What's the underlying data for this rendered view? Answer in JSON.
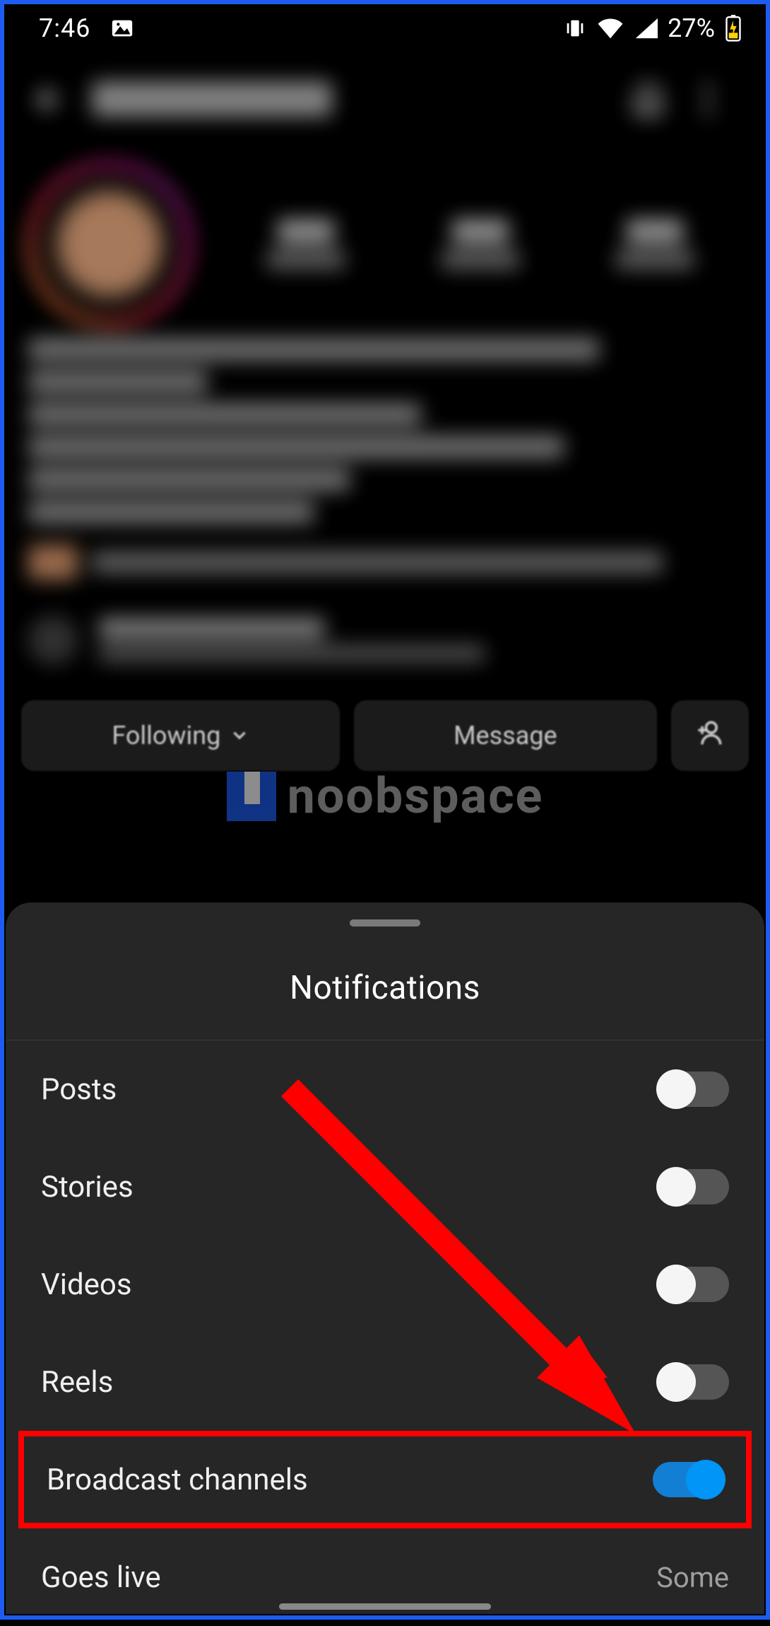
{
  "status": {
    "time": "7:46",
    "battery_pct": "27%"
  },
  "profile_actions": {
    "following_label": "Following",
    "message_label": "Message"
  },
  "watermark": {
    "text": "noobspace"
  },
  "sheet": {
    "title": "Notifications",
    "items": [
      {
        "label": "Posts",
        "on": false
      },
      {
        "label": "Stories",
        "on": false
      },
      {
        "label": "Videos",
        "on": false
      },
      {
        "label": "Reels",
        "on": false
      },
      {
        "label": "Broadcast channels",
        "on": true,
        "highlighted": true
      },
      {
        "label": "Goes live",
        "value": "Some"
      }
    ]
  }
}
